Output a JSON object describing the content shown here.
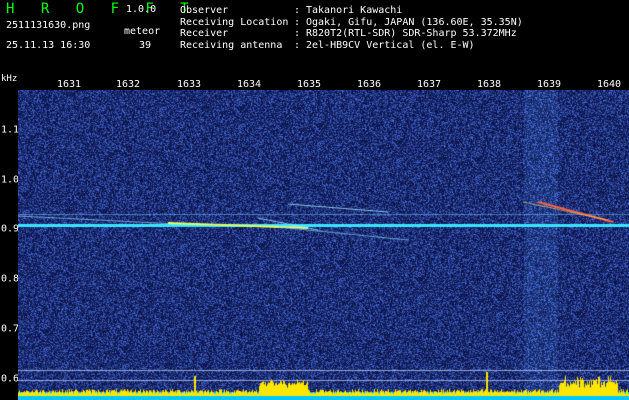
{
  "header": {
    "app_title": "H R O F F T",
    "app_version": "1.0.0",
    "file_name": "2511131630.png",
    "datetime": "25.11.13 16:30",
    "meteor_label": "meteor",
    "meteor_count": "39"
  },
  "info": [
    {
      "key": "Observer",
      "sep": ":",
      "value": "Takanori Kawachi"
    },
    {
      "key": "Receiving Location",
      "sep": ":",
      "value": "Ogaki, Gifu, JAPAN (136.60E, 35.35N)"
    },
    {
      "key": "Receiver",
      "sep": ":",
      "value": "R820T2(RTL-SDR) SDR-Sharp 53.372MHz"
    },
    {
      "key": "Receiving antenna",
      "sep": ":",
      "value": "2el-HB9CV Vertical (el. E-W)"
    }
  ],
  "axis": {
    "freq_unit": "kHz",
    "time_ticks": [
      "1631",
      "1632",
      "1633",
      "1634",
      "1635",
      "1636",
      "1637",
      "1638",
      "1639",
      "1640"
    ],
    "freq_ticks": [
      "1.1",
      "1.0",
      "0.9",
      "0.8",
      "0.7",
      "0.6"
    ]
  },
  "colors": {
    "title": "#00ff00",
    "background": "#000000",
    "spectrum_bg": "#0e1a5e",
    "carrier": "#37e6ff",
    "level_bar": "#ffe600",
    "level_base": "#00c8ff"
  }
}
